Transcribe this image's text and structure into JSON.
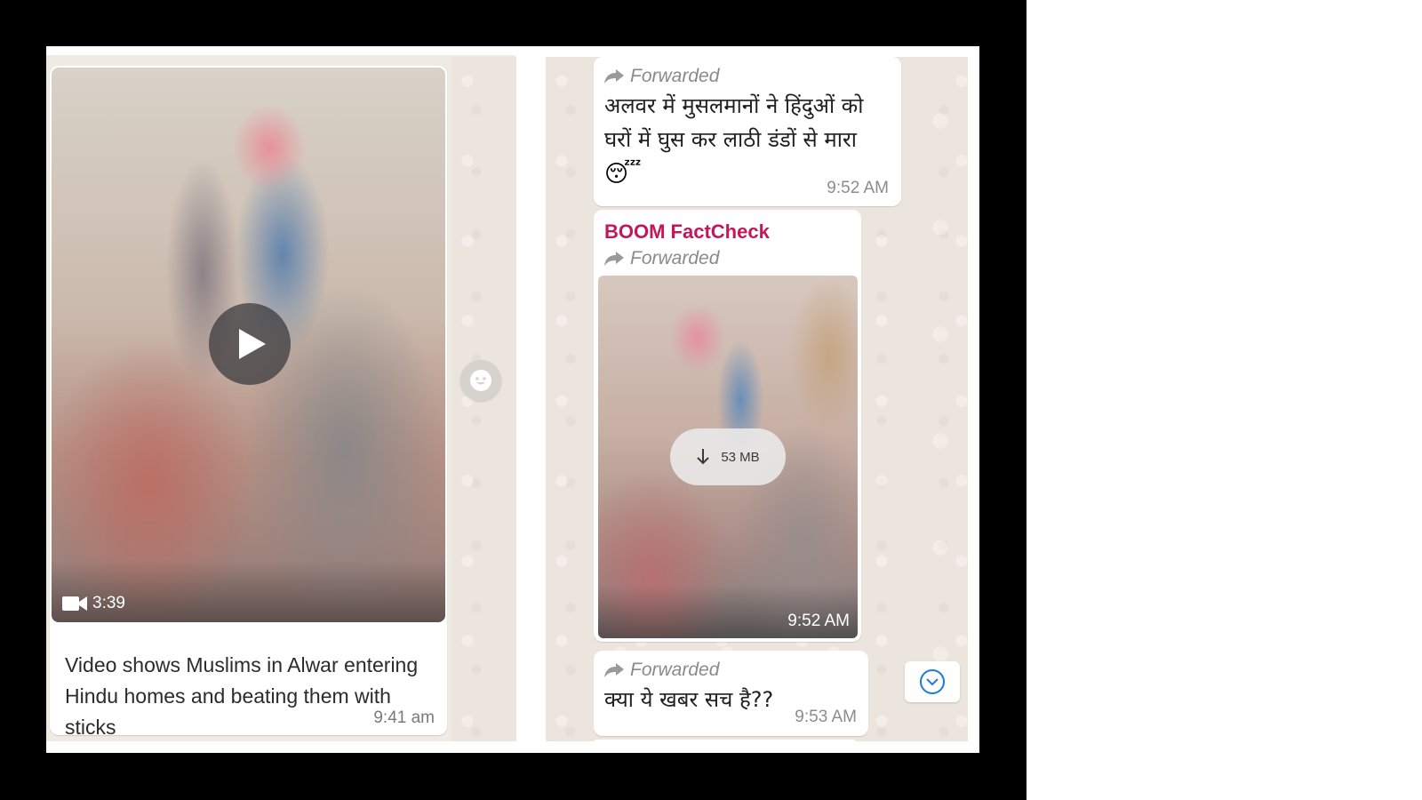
{
  "left_panel": {
    "video": {
      "duration": "3:39"
    },
    "caption": "Video shows Muslims in Alwar entering Hindu homes and beating them with sticks",
    "time": "9:41 am"
  },
  "right_panel": {
    "message1": {
      "forwarded_label": "Forwarded",
      "text": "अलवर में मुसलमानों ने हिंदुओं को घरों में घुस कर लाठी डंडों से मारा",
      "emoji": "😴",
      "time": "9:52 AM"
    },
    "message2": {
      "sender": "BOOM FactCheck",
      "forwarded_label": "Forwarded",
      "download_size": "53 MB",
      "time": "9:52 AM"
    },
    "message3": {
      "forwarded_label": "Forwarded",
      "text": "क्या ये खबर सच है??",
      "time": "9:53 AM"
    }
  },
  "icons": {
    "play": "play-icon",
    "video_camera": "video-camera-icon",
    "emoji": "emoji-icon",
    "forward": "forward-arrow-icon",
    "download": "download-arrow-icon",
    "scroll_down": "chevron-down-circle-icon"
  },
  "colors": {
    "sender": "#c2185b",
    "chat_background": "#ece5dd",
    "accent_blue": "#1e7bd6"
  }
}
